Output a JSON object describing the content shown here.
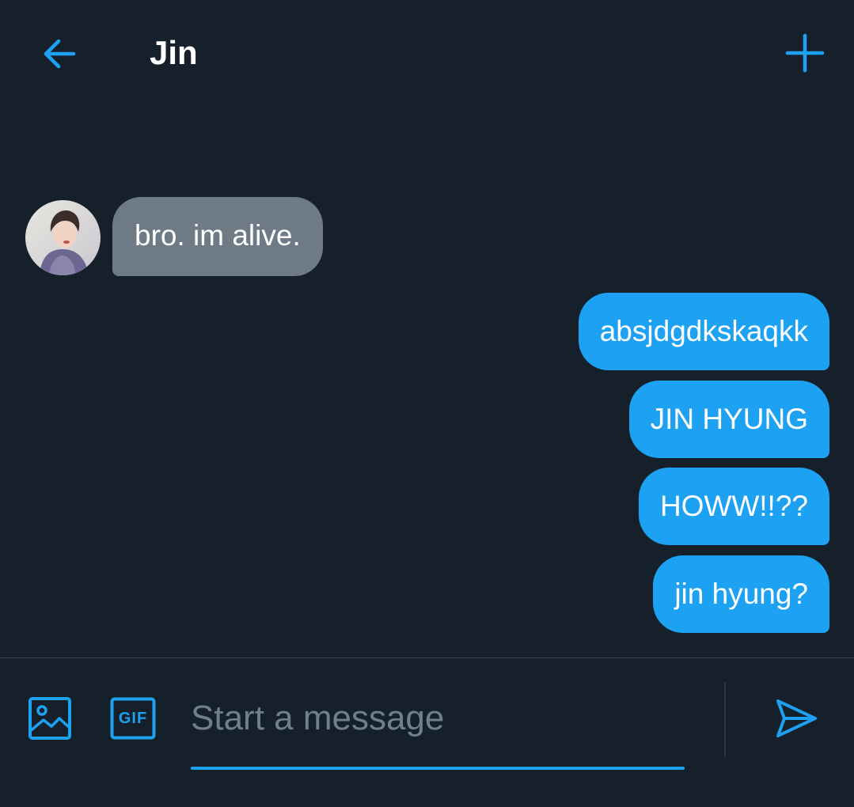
{
  "header": {
    "title": "Jin",
    "back_icon": "arrow-left-icon",
    "new_icon": "plus-icon"
  },
  "colors": {
    "background": "#16202b",
    "accent": "#1da1f2",
    "incoming_bubble": "#6e7a86",
    "placeholder": "#6e7f8e"
  },
  "messages": {
    "incoming": [
      {
        "text": "bro. im alive."
      }
    ],
    "outgoing": [
      {
        "text": "absjdgdkskaqkk"
      },
      {
        "text": "JIN HYUNG"
      },
      {
        "text": "HOWW!!??"
      },
      {
        "text": "jin hyung?"
      }
    ]
  },
  "composer": {
    "placeholder": "Start a message",
    "value": "",
    "image_icon": "image-icon",
    "gif_label": "GIF",
    "send_icon": "send-icon"
  }
}
